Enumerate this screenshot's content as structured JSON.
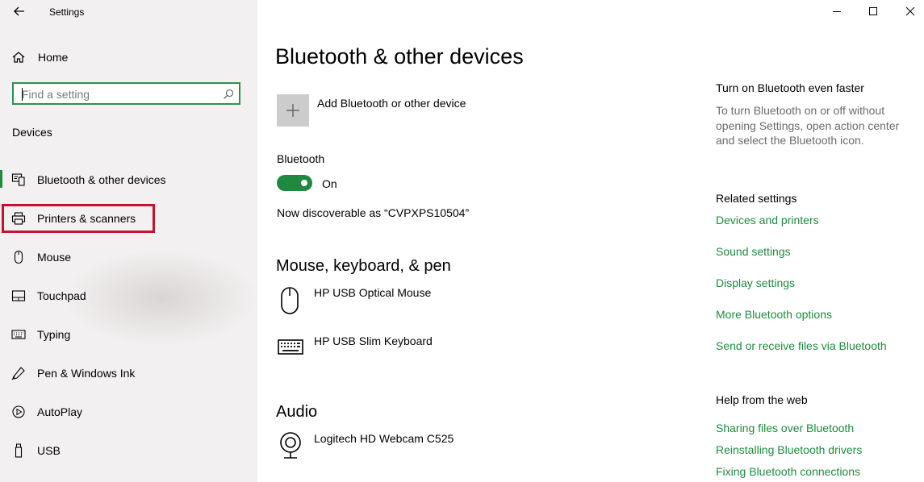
{
  "window": {
    "title": "Settings"
  },
  "sidebar": {
    "home_label": "Home",
    "search": {
      "placeholder": "Find a setting"
    },
    "section_label": "Devices",
    "items": [
      {
        "label": "Bluetooth & other devices",
        "icon": "bluetooth-devices-icon",
        "active": true
      },
      {
        "label": "Printers & scanners",
        "icon": "printer-icon",
        "highlighted": true
      },
      {
        "label": "Mouse",
        "icon": "mouse-icon"
      },
      {
        "label": "Touchpad",
        "icon": "touchpad-icon"
      },
      {
        "label": "Typing",
        "icon": "keyboard-icon"
      },
      {
        "label": "Pen & Windows Ink",
        "icon": "pen-icon"
      },
      {
        "label": "AutoPlay",
        "icon": "autoplay-icon"
      },
      {
        "label": "USB",
        "icon": "usb-icon"
      }
    ]
  },
  "main": {
    "title": "Bluetooth & other devices",
    "add_device_label": "Add Bluetooth or other device",
    "bluetooth_label": "Bluetooth",
    "bluetooth_state": "On",
    "discoverable_text": "Now discoverable as “CVPXPS10504”",
    "mouse_section": {
      "title": "Mouse, keyboard, & pen",
      "devices": [
        {
          "name": "HP USB Optical Mouse",
          "icon": "mouse-device-icon"
        },
        {
          "name": "HP USB Slim Keyboard",
          "icon": "keyboard-device-icon"
        }
      ]
    },
    "audio_section": {
      "title": "Audio",
      "devices": [
        {
          "name": "Logitech HD Webcam C525",
          "icon": "webcam-device-icon"
        }
      ]
    }
  },
  "right_panel": {
    "tip_title": "Turn on Bluetooth even faster",
    "tip_text": "To turn Bluetooth on or off without opening Settings, open action center and select the Bluetooth icon.",
    "related_title": "Related settings",
    "related_links": [
      "Devices and printers",
      "Sound settings",
      "Display settings",
      "More Bluetooth options",
      "Send or receive files via Bluetooth"
    ],
    "help_title": "Help from the web",
    "help_links": [
      "Sharing files over Bluetooth",
      "Reinstalling Bluetooth drivers",
      "Fixing Bluetooth connections"
    ]
  },
  "colors": {
    "accent": "#1f8a3f",
    "highlight_border": "#c4122f",
    "add_tile": "#cccccc"
  }
}
